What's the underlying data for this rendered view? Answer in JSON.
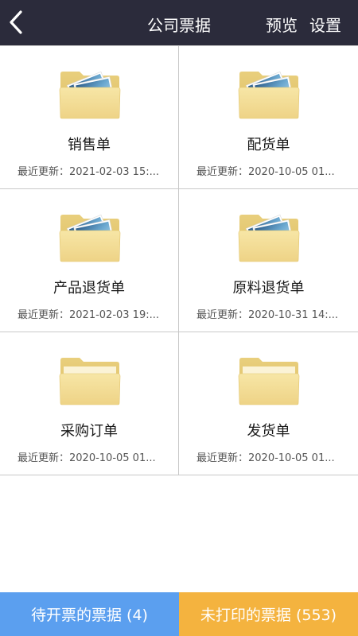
{
  "header": {
    "title": "公司票据",
    "preview_label": "预览",
    "settings_label": "设置"
  },
  "folders": [
    {
      "name": "销售单",
      "updated": "最近更新：2021-02-03 15:...",
      "has_photos": true
    },
    {
      "name": "配货单",
      "updated": "最近更新：2020-10-05 01...",
      "has_photos": true
    },
    {
      "name": "产品退货单",
      "updated": "最近更新：2021-02-03 19:...",
      "has_photos": true
    },
    {
      "name": "原料退货单",
      "updated": "最近更新：2020-10-31 14:...",
      "has_photos": true
    },
    {
      "name": "采购订单",
      "updated": "最近更新：2020-10-05 01...",
      "has_photos": false
    },
    {
      "name": "发货单",
      "updated": "最近更新：2020-10-05 01...",
      "has_photos": false
    }
  ],
  "bottom": {
    "pending_label": "待开票的票据 (4)",
    "unprinted_label": "未打印的票据 (553)"
  },
  "colors": {
    "header_bg": "#2b2b3b",
    "pending_bg": "#5b9fef",
    "unprinted_bg": "#f4b33f",
    "folder": "#f3dd95"
  }
}
